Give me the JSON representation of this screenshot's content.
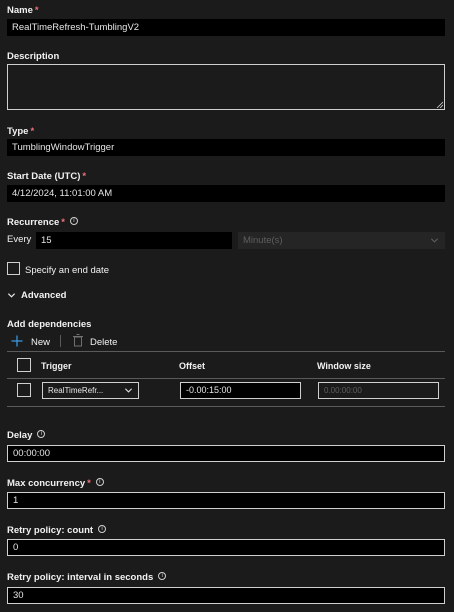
{
  "form": {
    "name": {
      "label": "Name",
      "value": "RealTimeRefresh-TumblingV2"
    },
    "description": {
      "label": "Description",
      "value": ""
    },
    "type": {
      "label": "Type",
      "value": "TumblingWindowTrigger"
    },
    "start_date": {
      "label": "Start Date (UTC)",
      "value": "4/12/2024, 11:01:00 AM"
    },
    "recurrence": {
      "label": "Recurrence",
      "every_label": "Every",
      "every_value": "15",
      "unit_placeholder": "Minute(s)"
    },
    "end_date": {
      "label": "Specify an end date"
    },
    "advanced": {
      "label": "Advanced"
    },
    "dependencies": {
      "label": "Add dependencies",
      "new_label": "New",
      "delete_label": "Delete",
      "columns": [
        "Trigger",
        "Offset",
        "Window size"
      ],
      "rows": [
        {
          "trigger": "RealTimeRefr...",
          "offset": "-0.00:15:00",
          "window_size_placeholder": "0.00:00:00"
        }
      ]
    },
    "delay": {
      "label": "Delay",
      "value": "00:00:00"
    },
    "max_concurrency": {
      "label": "Max concurrency",
      "value": "1"
    },
    "retry_count": {
      "label": "Retry policy: count",
      "value": "0"
    },
    "retry_interval": {
      "label": "Retry policy: interval in seconds",
      "value": "30"
    }
  },
  "icons": {
    "info": "i",
    "add": "plus-icon",
    "delete": "trash-icon",
    "expand": "chevron-down-icon"
  },
  "colors": {
    "required": "#f1707b",
    "accent": "#3a96dd",
    "field_bg": "#000000",
    "page_bg": "#1b1b1b"
  }
}
